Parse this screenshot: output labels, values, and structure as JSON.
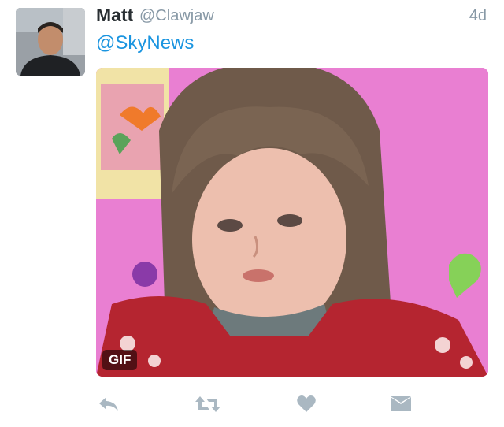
{
  "tweet": {
    "author_name": "Matt",
    "author_handle": "@Clawjaw",
    "timestamp": "4d",
    "text": "@SkyNews",
    "media": {
      "type": "gif",
      "badge_label": "GIF"
    }
  },
  "actions": [
    {
      "name": "reply",
      "icon": "reply-icon"
    },
    {
      "name": "retweet",
      "icon": "retweet-icon"
    },
    {
      "name": "like",
      "icon": "heart-icon"
    },
    {
      "name": "message",
      "icon": "envelope-icon"
    }
  ],
  "colors": {
    "name": "#292f33",
    "meta": "#8899a6",
    "link": "#1b95e0",
    "icon": "#aab8c2"
  }
}
